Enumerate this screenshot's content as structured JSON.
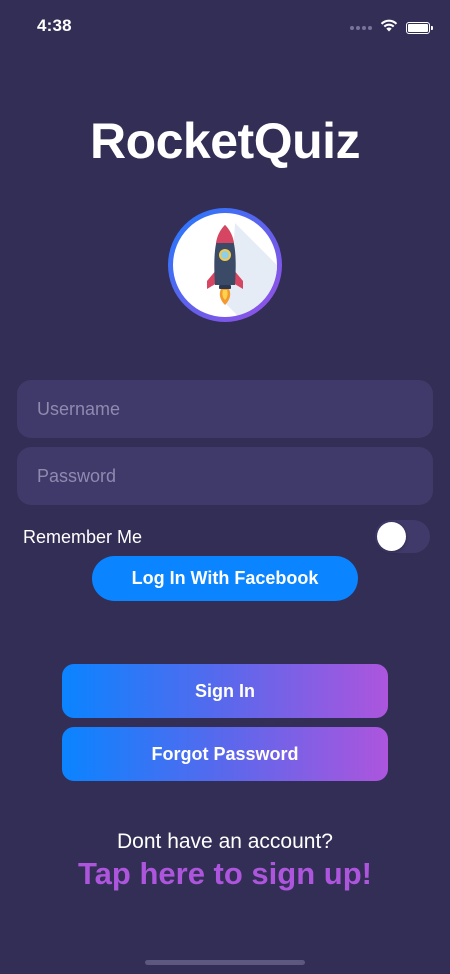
{
  "status_bar": {
    "time": "4:38",
    "icons": [
      "signal-icon",
      "wifi-icon",
      "battery-icon"
    ]
  },
  "app": {
    "title": "RocketQuiz",
    "logo_icon": "rocket-icon"
  },
  "form": {
    "username_placeholder": "Username",
    "password_placeholder": "Password",
    "username_value": "",
    "password_value": "",
    "remember_label": "Remember Me",
    "remember_on": false
  },
  "buttons": {
    "facebook_label": "Log In With Facebook",
    "signin_label": "Sign In",
    "forgot_label": "Forgot Password"
  },
  "footer": {
    "no_account_text": "Dont have an account?",
    "signup_text": "Tap here to sign up!"
  },
  "colors": {
    "background": "#332e56",
    "field_bg": "#403a6a",
    "accent_blue": "#0a84ff",
    "accent_purple": "#ad55dd",
    "placeholder": "#8f8ab0"
  }
}
